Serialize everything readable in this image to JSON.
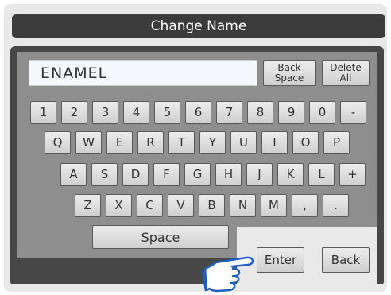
{
  "title": "Change Name",
  "name_field": {
    "value": "ENAMEL"
  },
  "control_keys": {
    "back_space": "Back Space",
    "delete_all": "Delete All"
  },
  "rows": {
    "numbers": [
      "1",
      "2",
      "3",
      "4",
      "5",
      "6",
      "7",
      "8",
      "9",
      "0",
      "-"
    ],
    "qwerty": [
      "Q",
      "W",
      "E",
      "R",
      "T",
      "Y",
      "U",
      "I",
      "O",
      "P"
    ],
    "asdf": [
      "A",
      "S",
      "D",
      "F",
      "G",
      "H",
      "J",
      "K",
      "L",
      "+"
    ],
    "zxcv": [
      "Z",
      "X",
      "C",
      "V",
      "B",
      "N",
      "M",
      ",",
      "."
    ]
  },
  "space_label": "Space",
  "enter_label": "Enter",
  "back_label": "Back",
  "colors": {
    "title_bar": "#3b3b3b",
    "keyboard_frame": "#474747",
    "keyboard_inner": "#8e8e8e",
    "panel_bg": "#e9e9e9",
    "hand_fill": "#ffffff",
    "hand_outline": "#1f5fc2"
  },
  "icons": {
    "pointer": "pointing-hand-icon"
  }
}
